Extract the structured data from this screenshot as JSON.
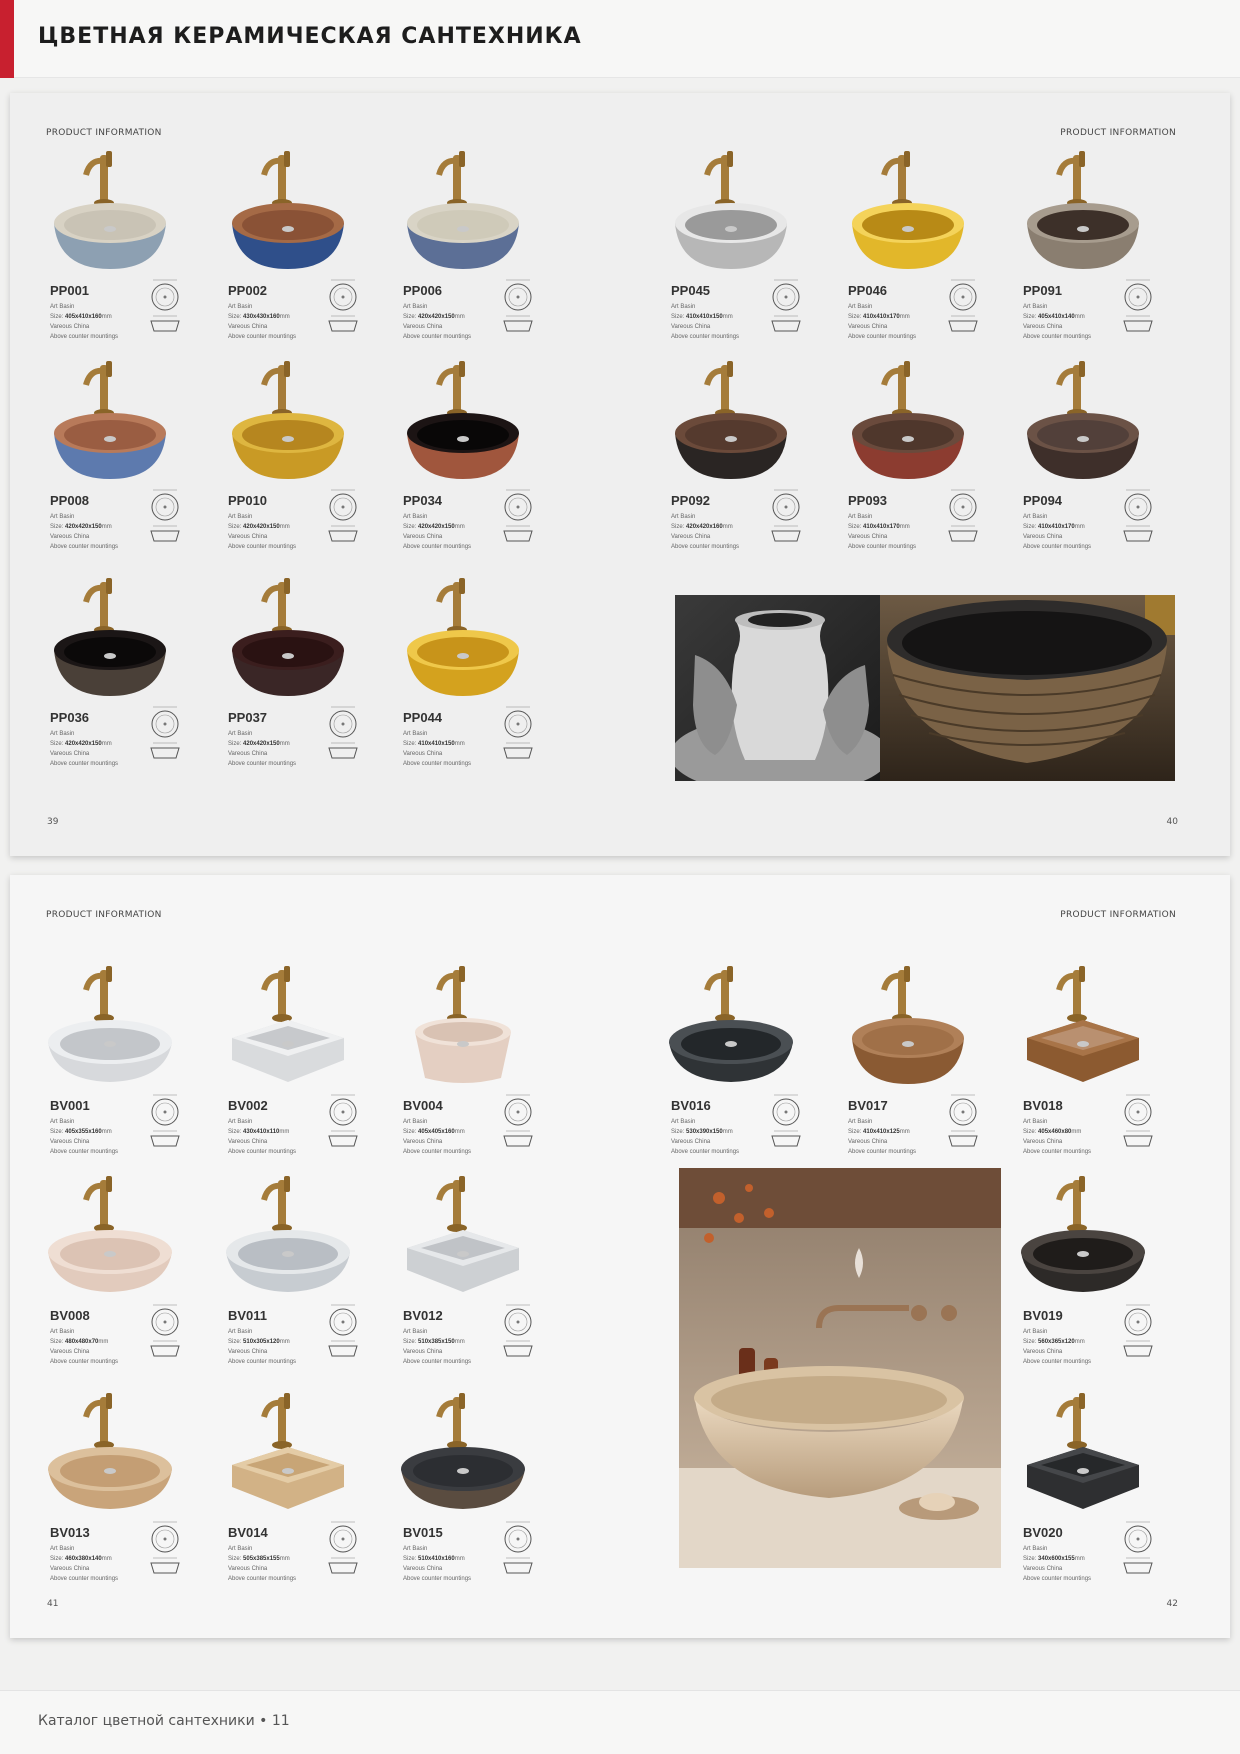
{
  "header": {
    "title": "ЦВЕТНАЯ КЕРАМИЧЕСКАЯ САНТЕХНИКА"
  },
  "footer": {
    "text": "Каталог цветной сантехники  •  11"
  },
  "spreads": [
    {
      "left_label": "PRODUCT INFORMATION",
      "right_label": "PRODUCT INFORMATION",
      "left_page": "39",
      "right_page": "40",
      "products": [
        {
          "code": "PP001",
          "type": "Art Basin",
          "size_label": "Size:",
          "size": "405x410x160",
          "unit": "mm",
          "origin": "Vareous China",
          "mount": "Above counter mountings",
          "bowl": "#8da0b2",
          "rim": "#d8d2c4",
          "inner": "#c9c3b5",
          "shape": "round"
        },
        {
          "code": "PP002",
          "type": "Art Basin",
          "size_label": "Size:",
          "size": "430x430x160",
          "unit": "mm",
          "origin": "Vareous China",
          "mount": "Above counter mountings",
          "bowl": "#2f4f8a",
          "rim": "#a56a46",
          "inner": "#8a5236",
          "shape": "round"
        },
        {
          "code": "PP006",
          "type": "Art Basin",
          "size_label": "Size:",
          "size": "420x420x150",
          "unit": "mm",
          "origin": "Vareous China",
          "mount": "Above counter mountings",
          "bowl": "#5c6f96",
          "rim": "#d9d4c6",
          "inner": "#cfcab9",
          "shape": "round"
        },
        {
          "code": "PP045",
          "type": "Art Basin",
          "size_label": "Size:",
          "size": "410x410x150",
          "unit": "mm",
          "origin": "Vareous China",
          "mount": "Above counter mountings",
          "bowl": "#b7b7b7",
          "rim": "#e7e7e7",
          "inner": "#9a9a9a",
          "shape": "round"
        },
        {
          "code": "PP046",
          "type": "Art Basin",
          "size_label": "Size:",
          "size": "410x410x170",
          "unit": "mm",
          "origin": "Vareous China",
          "mount": "Above counter mountings",
          "bowl": "#e2b72a",
          "rim": "#f4d35a",
          "inner": "#b88a16",
          "shape": "round"
        },
        {
          "code": "PP091",
          "type": "Art Basin",
          "size_label": "Size:",
          "size": "405x410x140",
          "unit": "mm",
          "origin": "Vareous China",
          "mount": "Above counter mountings",
          "bowl": "#8a7e70",
          "rim": "#a79c8e",
          "inner": "#3d3029",
          "shape": "round"
        },
        {
          "code": "PP008",
          "type": "Art Basin",
          "size_label": "Size:",
          "size": "420x420x150",
          "unit": "mm",
          "origin": "Vareous China",
          "mount": "Above counter mountings",
          "bowl": "#5d7aae",
          "rim": "#b87a5a",
          "inner": "#9a5d42",
          "shape": "round"
        },
        {
          "code": "PP010",
          "type": "Art Basin",
          "size_label": "Size:",
          "size": "420x420x150",
          "unit": "mm",
          "origin": "Vareous China",
          "mount": "Above counter mountings",
          "bowl": "#c99a25",
          "rim": "#deb640",
          "inner": "#b6861f",
          "shape": "round"
        },
        {
          "code": "PP034",
          "type": "Art Basin",
          "size_label": "Size:",
          "size": "420x420x150",
          "unit": "mm",
          "origin": "Vareous China",
          "mount": "Above counter mountings",
          "bowl": "#a0563d",
          "rim": "#1c1414",
          "inner": "#090707",
          "shape": "round"
        },
        {
          "code": "PP092",
          "type": "Art Basin",
          "size_label": "Size:",
          "size": "420x420x160",
          "unit": "mm",
          "origin": "Vareous China",
          "mount": "Above counter mountings",
          "bowl": "#2a2523",
          "rim": "#6b4a3a",
          "inner": "#553a2e",
          "shape": "round"
        },
        {
          "code": "PP093",
          "type": "Art Basin",
          "size_label": "Size:",
          "size": "410x410x170",
          "unit": "mm",
          "origin": "Vareous China",
          "mount": "Above counter mountings",
          "bowl": "#8c3c30",
          "rim": "#6a4a3c",
          "inner": "#4f372c",
          "shape": "round"
        },
        {
          "code": "PP094",
          "type": "Art Basin",
          "size_label": "Size:",
          "size": "410x410x170",
          "unit": "mm",
          "origin": "Vareous China",
          "mount": "Above counter mountings",
          "bowl": "#3e2f2a",
          "rim": "#6b5246",
          "inner": "#52403a",
          "shape": "round"
        },
        {
          "code": "PP036",
          "type": "Art Basin",
          "size_label": "Size:",
          "size": "420x420x150",
          "unit": "mm",
          "origin": "Vareous China",
          "mount": "Above counter mountings",
          "bowl": "#4a4038",
          "rim": "#1b1616",
          "inner": "#0b0909",
          "shape": "round"
        },
        {
          "code": "PP037",
          "type": "Art Basin",
          "size_label": "Size:",
          "size": "420x420x150",
          "unit": "mm",
          "origin": "Vareous China",
          "mount": "Above counter mountings",
          "bowl": "#3a2626",
          "rim": "#3b1e1e",
          "inner": "#2a1212",
          "shape": "round"
        },
        {
          "code": "PP044",
          "type": "Art Basin",
          "size_label": "Size:",
          "size": "410x410x150",
          "unit": "mm",
          "origin": "Vareous China",
          "mount": "Above counter mountings",
          "bowl": "#d4a21e",
          "rim": "#efc84a",
          "inner": "#c8941a",
          "shape": "round"
        }
      ]
    },
    {
      "left_label": "PRODUCT INFORMATION",
      "right_label": "PRODUCT INFORMATION",
      "left_page": "41",
      "right_page": "42",
      "products": [
        {
          "code": "BV001",
          "type": "Art Basin",
          "size_label": "Size:",
          "size": "405x355x160",
          "unit": "mm",
          "origin": "Vareous China",
          "mount": "Above counter mountings",
          "bowl": "#d7d9dc",
          "rim": "#eceef0",
          "inner": "#c3c6ca",
          "shape": "oval"
        },
        {
          "code": "BV002",
          "type": "Art Basin",
          "size_label": "Size:",
          "size": "430x410x110",
          "unit": "mm",
          "origin": "Vareous China",
          "mount": "Above counter mountings",
          "bowl": "#d9dbdd",
          "rim": "#eff0f1",
          "inner": "#c7c9cc",
          "shape": "square"
        },
        {
          "code": "BV004",
          "type": "Art Basin",
          "size_label": "Size:",
          "size": "405x405x160",
          "unit": "mm",
          "origin": "Vareous China",
          "mount": "Above counter mountings",
          "bowl": "#e4cfc2",
          "rim": "#f0e2d8",
          "inner": "#d9c2b3",
          "shape": "cylinder"
        },
        {
          "code": "BV016",
          "type": "Art Basin",
          "size_label": "Size:",
          "size": "530x390x150",
          "unit": "mm",
          "origin": "Vareous China",
          "mount": "Above counter mountings",
          "bowl": "#2f3336",
          "rim": "#4a4f53",
          "inner": "#23272a",
          "shape": "oval"
        },
        {
          "code": "BV017",
          "type": "Art Basin",
          "size_label": "Size:",
          "size": "410x410x125",
          "unit": "mm",
          "origin": "Vareous China",
          "mount": "Above counter mountings",
          "bowl": "#8a5a33",
          "rim": "#b08058",
          "inner": "#a07048",
          "shape": "round"
        },
        {
          "code": "BV018",
          "type": "Art Basin",
          "size_label": "Size:",
          "size": "405x460x80",
          "unit": "mm",
          "origin": "Vareous China",
          "mount": "Above counter mountings",
          "bowl": "#8c5a30",
          "rim": "#a87448",
          "inner": "#b99070",
          "shape": "square"
        },
        {
          "code": "BV008",
          "type": "Art Basin",
          "size_label": "Size:",
          "size": "480x480x70",
          "unit": "mm",
          "origin": "Vareous China",
          "mount": "Above counter mountings",
          "bowl": "#e2cbbd",
          "rim": "#efded3",
          "inner": "#dcc3b4",
          "shape": "oval"
        },
        {
          "code": "BV011",
          "type": "Art Basin",
          "size_label": "Size:",
          "size": "510x305x120",
          "unit": "mm",
          "origin": "Vareous China",
          "mount": "Above counter mountings",
          "bowl": "#c7ccd1",
          "rim": "#e5e8ea",
          "inner": "#b9bec4",
          "shape": "oval"
        },
        {
          "code": "BV012",
          "type": "Art Basin",
          "size_label": "Size:",
          "size": "510x385x150",
          "unit": "mm",
          "origin": "Vareous China",
          "mount": "Above counter mountings",
          "bowl": "#cdd0d3",
          "rim": "#e6e8ea",
          "inner": "#c0c3c7",
          "shape": "square"
        },
        {
          "code": "BV019",
          "type": "Art Basin",
          "size_label": "Size:",
          "size": "560x365x120",
          "unit": "mm",
          "origin": "Vareous China",
          "mount": "Above counter mountings",
          "bowl": "#2d2a28",
          "rim": "#4a4440",
          "inner": "#1f1c1a",
          "shape": "oval"
        },
        {
          "code": "BV013",
          "type": "Art Basin",
          "size_label": "Size:",
          "size": "460x380x140",
          "unit": "mm",
          "origin": "Vareous China",
          "mount": "Above counter mountings",
          "bowl": "#c9a47a",
          "rim": "#dcc09c",
          "inner": "#c49e74",
          "shape": "oval"
        },
        {
          "code": "BV014",
          "type": "Art Basin",
          "size_label": "Size:",
          "size": "505x385x155",
          "unit": "mm",
          "origin": "Vareous China",
          "mount": "Above counter mountings",
          "bowl": "#d2b286",
          "rim": "#e4cca6",
          "inner": "#c8a576",
          "shape": "square"
        },
        {
          "code": "BV015",
          "type": "Art Basin",
          "size_label": "Size:",
          "size": "510x410x160",
          "unit": "mm",
          "origin": "Vareous China",
          "mount": "Above counter mountings",
          "bowl": "#5a4c40",
          "rim": "#3a3c40",
          "inner": "#2c2e32",
          "shape": "oval"
        },
        {
          "code": "BV020",
          "type": "Art Basin",
          "size_label": "Size:",
          "size": "340x600x155",
          "unit": "mm",
          "origin": "Vareous China",
          "mount": "Above counter mountings",
          "bowl": "#2e2f31",
          "rim": "#45474a",
          "inner": "#26282a",
          "shape": "square"
        }
      ]
    }
  ]
}
